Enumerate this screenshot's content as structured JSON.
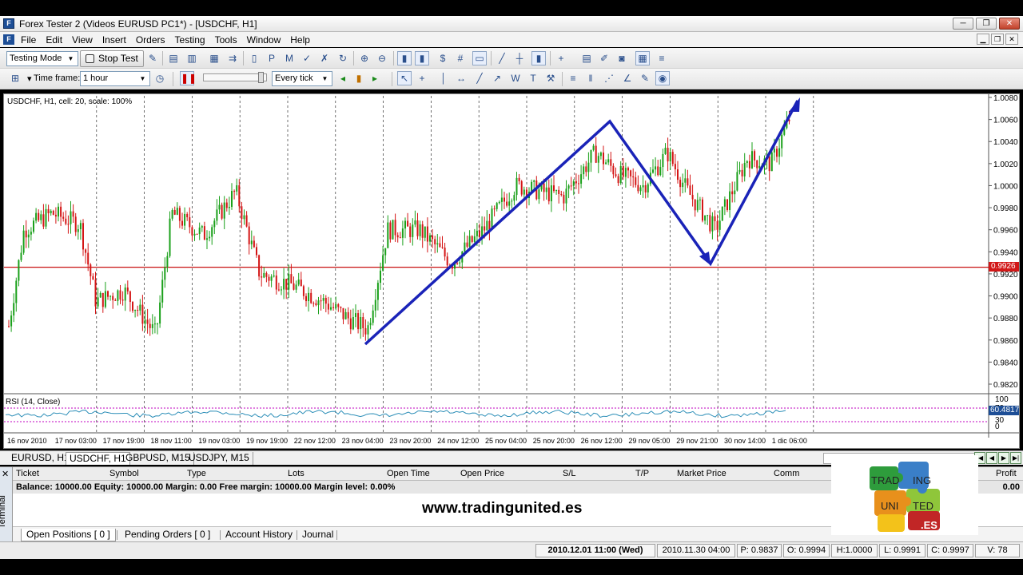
{
  "window": {
    "title": "Forex Tester 2  (Videos EURUSD PC1*) - [USDCHF, H1]",
    "controls": [
      "─",
      "❐",
      "✕"
    ]
  },
  "menu": [
    "File",
    "Edit",
    "View",
    "Insert",
    "Orders",
    "Testing",
    "Tools",
    "Window",
    "Help"
  ],
  "toolbar1": {
    "mode_select": "Testing Mode",
    "stop_test_label": "Stop Test"
  },
  "toolbar2": {
    "timeframe_label": "Time frame:",
    "timeframe_value": "1 hour",
    "tick_mode_value": "Every tick"
  },
  "chart": {
    "caption": "USDCHF, H1, cell: 20, scale: 100%",
    "rsi_caption": "RSI (14, Close)",
    "current_price_tag": "0.9926",
    "rsi_value_tag": "60.4817",
    "price_axis": [
      "1.0080",
      "1.0060",
      "1.0040",
      "1.0020",
      "1.0000",
      "0.9980",
      "0.9960",
      "0.9940",
      "0.9920",
      "0.9900",
      "0.9880",
      "0.9860",
      "0.9840",
      "0.9820"
    ],
    "rsi_axis": [
      "100",
      "70",
      "30",
      "0"
    ],
    "time_axis": [
      "16 nov 2010",
      "17 nov 03:00",
      "17 nov 19:00",
      "18 nov 11:00",
      "19 nov 03:00",
      "19 nov 19:00",
      "22 nov 12:00",
      "23 nov 04:00",
      "23 nov 20:00",
      "24 nov 12:00",
      "25 nov 04:00",
      "25 nov 20:00",
      "26 nov 12:00",
      "29 nov 05:00",
      "29 nov 21:00",
      "30 nov 14:00",
      "1 dic 06:00"
    ],
    "colors": {
      "bull": "#1aa01a",
      "bear": "#d41515",
      "drawing": "#1a23b8",
      "level": "#c81010",
      "rsi": "#2d8fb8"
    }
  },
  "chart_tabs": [
    "EURUSD, H1",
    "USDCHF, H1",
    "GBPUSD, M15",
    "USDJPY, M15"
  ],
  "active_chart_tab": "USDCHF, H1",
  "terminal": {
    "side_label": "Terminal",
    "columns": [
      "Ticket",
      "Symbol",
      "Type",
      "Lots",
      "Open Time",
      "Open Price",
      "S/L",
      "T/P",
      "Market Price",
      "Comm",
      "Profit"
    ],
    "balance_line": "Balance: 10000.00 Equity: 10000.00 Margin: 0.00 Free margin: 10000.00 Margin level: 0.00%",
    "balance_profit": "0.00",
    "tabs": [
      "Open Positions  [ 0 ]",
      "Pending Orders  [ 0 ]",
      "Account History",
      "Journal"
    ]
  },
  "watermark": {
    "url": "www.tradingunited.es",
    "logo_words": [
      "TRAD",
      "ING",
      "UNI",
      "TED",
      ".ES"
    ]
  },
  "status": {
    "datetime": "2010.12.01 11:00 (Wed)",
    "bar_time": "2010.11.30 04:00",
    "p": "P: 0.9837",
    "o": "O: 0.9994",
    "h": "H:1.0000",
    "l": "L: 0.9991",
    "c": "C: 0.9997",
    "v": "V: 78"
  }
}
